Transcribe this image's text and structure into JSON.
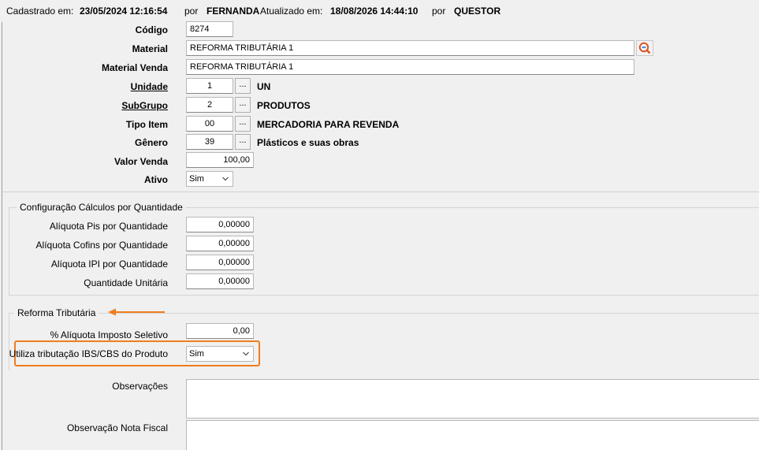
{
  "header": {
    "created_label": "Cadastrado em:",
    "created_value": "23/05/2024 12:16:54",
    "by_label_1": "por",
    "created_by": "FERNANDA",
    "updated_label": "Atualizado em:",
    "updated_value": "18/08/2026 14:44:10",
    "by_label_2": "por",
    "updated_by": "QUESTOR"
  },
  "form": {
    "codigo": {
      "label": "Código",
      "value": "8274"
    },
    "material": {
      "label": "Material",
      "value": "REFORMA TRIBUTÁRIA 1"
    },
    "material_venda": {
      "label": "Material Venda",
      "value": "REFORMA TRIBUTÁRIA 1"
    },
    "unidade": {
      "label": "Unidade",
      "value": "1",
      "button": "...",
      "description": "UN"
    },
    "subgrupo": {
      "label": "SubGrupo",
      "value": "2",
      "button": "...",
      "description": "PRODUTOS"
    },
    "tipo_item": {
      "label": "Tipo Item",
      "value": "00",
      "button": "...",
      "description": "MERCADORIA PARA REVENDA"
    },
    "genero": {
      "label": "Gênero",
      "value": "39",
      "button": "...",
      "description": "Plásticos e suas obras"
    },
    "valor_venda": {
      "label": "Valor Venda",
      "value": "100,00"
    },
    "ativo": {
      "label": "Ativo",
      "value": "Sim"
    }
  },
  "config_group": {
    "title": "Configuração Cálculos por Quantidade",
    "aliquota_pis": {
      "label": "Alíquota Pis por Quantidade",
      "value": "0,00000"
    },
    "aliquota_cofins": {
      "label": "Alíquota Cofins por Quantidade",
      "value": "0,00000"
    },
    "aliquota_ipi": {
      "label": "Alíquota IPI por Quantidade",
      "value": "0,00000"
    },
    "quantidade_unitaria": {
      "label": "Quantidade Unitária",
      "value": "0,00000"
    }
  },
  "reforma_group": {
    "title": "Reforma Tributária",
    "imposto_seletivo": {
      "label": "% Alíquota Imposto Seletivo",
      "value": "0,00"
    },
    "utiliza_ibs_cbs": {
      "label": "Utiliza tributação IBS/CBS do Produto",
      "value": "Sim"
    }
  },
  "observacoes": {
    "label": "Observações",
    "value": ""
  },
  "observacao_nf": {
    "label": "Observação Nota Fiscal",
    "value": ""
  },
  "colors": {
    "highlight": "#f07d1e",
    "search_icon": "#d9531e"
  },
  "icons": {
    "search": "search-icon",
    "chevron": "chevron-down-icon"
  }
}
